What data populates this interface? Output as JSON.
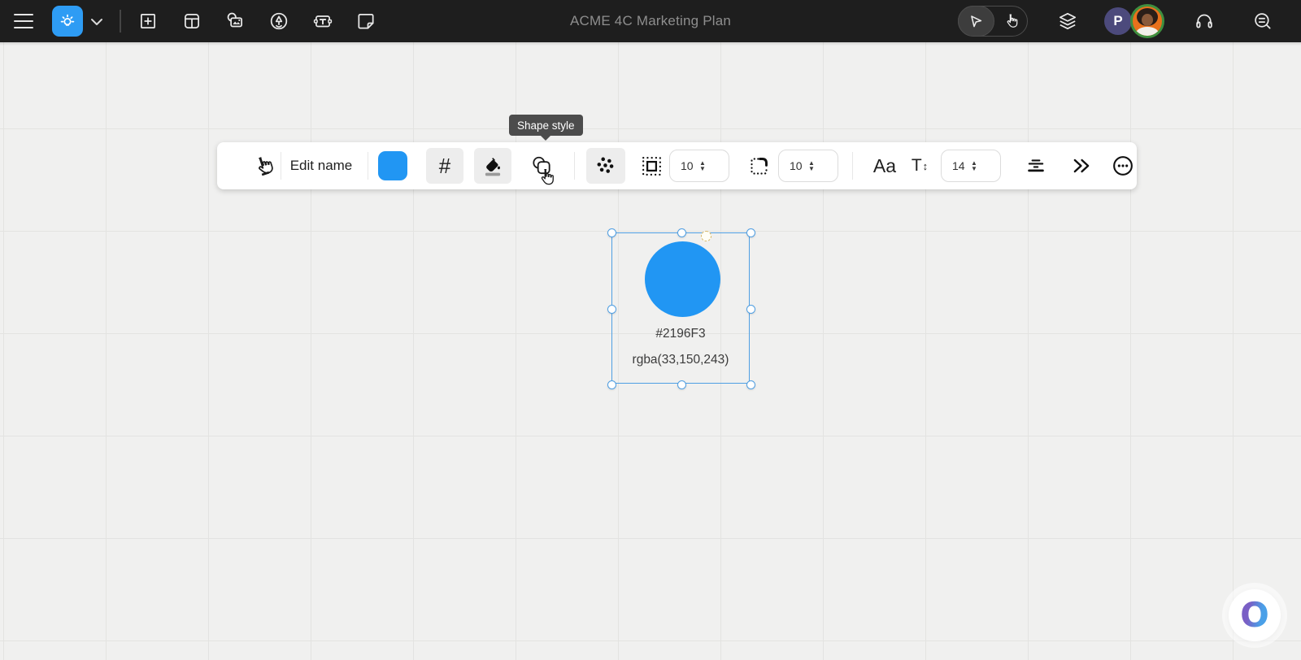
{
  "topbar": {
    "title": "ACME 4C Marketing Plan",
    "avatar_initial": "P"
  },
  "toolbar": {
    "edit_name_label": "Edit name",
    "hash_glyph": "#",
    "border_width_value": "10",
    "corner_radius_value": "10",
    "font_style_glyph": "Aa",
    "text_size_glyph": "T",
    "text_size_arrow": "↕",
    "font_size_value": "14",
    "shape_fill_color": "#2196F3",
    "tooltip_text": "Shape style"
  },
  "canvas": {
    "shape": {
      "fill_color": "#2196F3",
      "hex_label": "#2196F3",
      "rgba_label": "rgba(33,150,243)"
    }
  },
  "watermark_letter": "O",
  "colors": {
    "accent_blue": "#2196F3",
    "selection_blue": "#4F9FE3",
    "handle_amber": "#D8B867",
    "topbar_bg": "#1E1E1E",
    "canvas_bg": "#F0F0EF",
    "grid_line": "#E3E3E1",
    "tooltip_bg": "#4C4C4C",
    "app_logo_blue": "#2E9CF4",
    "avatar_purple": "#4C4A7C",
    "avatar_orange": "#E8711C",
    "avatar_ring_green": "#3F8F3F",
    "watermark_gradient_start": "#7A5FC5",
    "watermark_gradient_end": "#4AA0E8"
  },
  "icon_names": [
    "hamburger-menu-icon",
    "app-logo-bulb-icon",
    "chevron-down-icon",
    "insert-shape-icon",
    "template-icon",
    "media-icon",
    "draw-tool-icon",
    "text-box-icon",
    "sticky-note-icon",
    "cursor-tool-icon",
    "pan-hand-icon",
    "layers-icon",
    "headphones-icon",
    "search-icon",
    "pointer-hand-icon",
    "fill-bucket-icon",
    "shape-style-icon",
    "pattern-dots-icon",
    "border-style-icon",
    "corner-radius-icon",
    "align-icon",
    "expand-more-icon",
    "ellipsis-icon"
  ]
}
